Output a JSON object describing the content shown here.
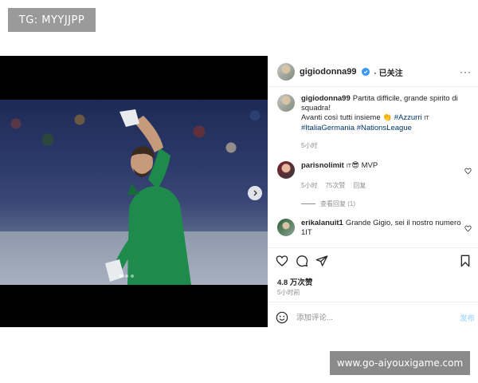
{
  "overlay": {
    "tg_badge": "TG: MYYJJPP",
    "bottom_watermark": "www.go-aiyouxigame.com"
  },
  "post": {
    "author": {
      "username": "gigiodonna99",
      "verified": true,
      "follow_label": "已关注",
      "more_label": "···"
    },
    "caption": {
      "username": "gigiodonna99",
      "line1": "Partita difficile, grande spirito di squadra!",
      "line2": "Avanti così tutti insieme",
      "hashtag1": "#Azzurri",
      "flag1": "IT",
      "hashtags2": "#ItaliaGermania #NationsLeague",
      "time": "5小时"
    },
    "comments": [
      {
        "username": "parisnolimit",
        "flag": "IT",
        "text": "MVP",
        "time": "5小时",
        "likes": "75次赞",
        "reply_label": "回复",
        "view_replies": "查看回复 (1)"
      },
      {
        "username": "erikalanuit1",
        "text": "Grande Gigio, sei il nostro numero",
        "text_tail": "1IT"
      }
    ],
    "likes_count": "4.8 万次赞",
    "time_ago": "5小时前",
    "comment_placeholder": "添加评论...",
    "post_button": "发布"
  },
  "carousel": {
    "slide_count": 3,
    "active_slide": 1
  },
  "colors": {
    "verified": "#3897f0",
    "hashtag": "#00376b",
    "muted": "#8e8e8e",
    "pitch_green": "#1e8a4c"
  },
  "icons": [
    "heart-icon",
    "comment-icon",
    "share-icon",
    "bookmark-icon",
    "emoji-icon",
    "chevron-right-icon",
    "more-icon"
  ]
}
